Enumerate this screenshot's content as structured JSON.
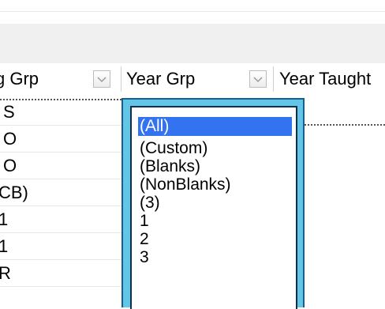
{
  "grid": {
    "headers": [
      {
        "label": "g Grp",
        "name": "header-reg-grp"
      },
      {
        "label": "Year Grp",
        "name": "header-year-grp"
      },
      {
        "label": "Year Taught",
        "name": "header-year-taught"
      }
    ],
    "rows": [
      "S",
      "O",
      "O",
      "CB)",
      "1",
      "1",
      "R"
    ]
  },
  "filter_dropdown": {
    "options": [
      "(All)",
      "(Custom)",
      "(Blanks)",
      "(NonBlanks)",
      "(3)",
      "1",
      "2",
      "3"
    ],
    "selected_index": 0
  },
  "colors": {
    "dropdown_frame": "#63c6e6",
    "selection": "#3373f0",
    "toolbar": "#f0f0f0"
  }
}
